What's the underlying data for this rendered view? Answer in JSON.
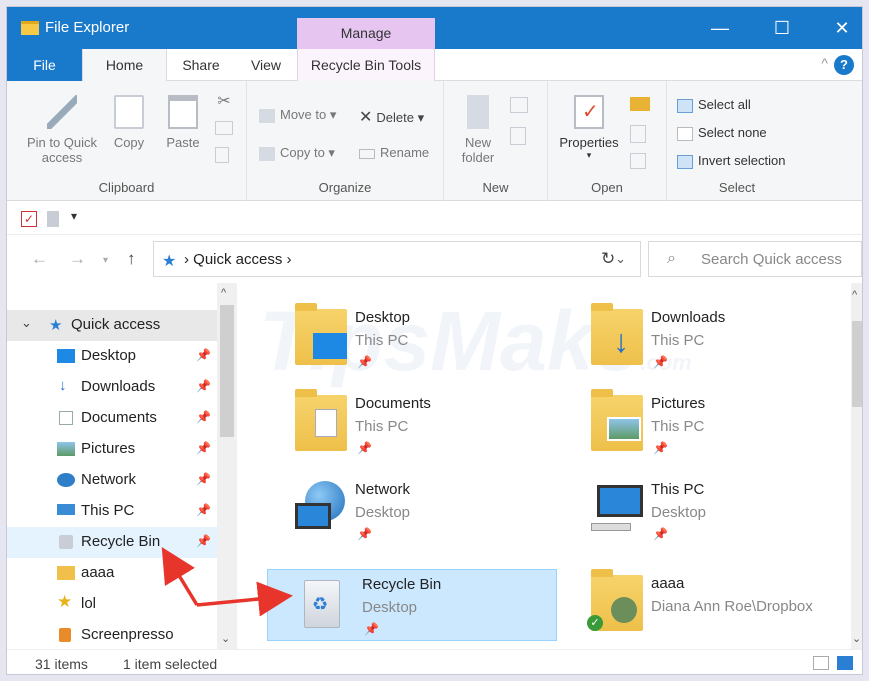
{
  "window": {
    "title": "File Explorer",
    "manage_tab": "Manage",
    "controls": {
      "minimize": "—",
      "maximize": "☐",
      "close": "✕"
    }
  },
  "ribbon_tabs": {
    "file": "File",
    "home": "Home",
    "share": "Share",
    "view": "View",
    "recycle_bin_tools": "Recycle Bin Tools",
    "collapse": "^",
    "help": "?"
  },
  "ribbon": {
    "clipboard": {
      "group": "Clipboard",
      "pin_line1": "Pin to Quick",
      "pin_line2": "access",
      "copy": "Copy",
      "paste": "Paste"
    },
    "organize": {
      "group": "Organize",
      "move_to": "Move to",
      "copy_to": "Copy to",
      "delete": "Delete",
      "rename": "Rename"
    },
    "new": {
      "group": "New",
      "new_folder_line1": "New",
      "new_folder_line2": "folder"
    },
    "open": {
      "group": "Open",
      "properties": "Properties"
    },
    "select": {
      "group": "Select",
      "select_all": "Select all",
      "select_none": "Select none",
      "invert_selection": "Invert selection"
    }
  },
  "address": {
    "path": "Quick access",
    "search_placeholder": "Search Quick access"
  },
  "nav": {
    "quick_access": "Quick access",
    "items": [
      {
        "label": "Desktop",
        "icon": "desktop-icon",
        "pinned": true
      },
      {
        "label": "Downloads",
        "icon": "download-icon",
        "pinned": true
      },
      {
        "label": "Documents",
        "icon": "documents-icon",
        "pinned": true
      },
      {
        "label": "Pictures",
        "icon": "pictures-icon",
        "pinned": true
      },
      {
        "label": "Network",
        "icon": "network-icon",
        "pinned": true
      },
      {
        "label": "This PC",
        "icon": "computer-icon",
        "pinned": true
      },
      {
        "label": "Recycle Bin",
        "icon": "recycle-bin-icon",
        "pinned": true
      },
      {
        "label": "aaaa",
        "icon": "user-folder-icon",
        "pinned": false
      },
      {
        "label": "lol",
        "icon": "star-folder-icon",
        "pinned": false
      },
      {
        "label": "Screenpresso",
        "icon": "app-icon",
        "pinned": false
      }
    ]
  },
  "content": {
    "watermark": "TipsMake",
    "watermark_sub": ".com",
    "tiles": [
      {
        "name": "Desktop",
        "location": "This PC",
        "icon": "desktop-folder-icon"
      },
      {
        "name": "Downloads",
        "location": "This PC",
        "icon": "downloads-folder-icon"
      },
      {
        "name": "Documents",
        "location": "This PC",
        "icon": "documents-folder-icon"
      },
      {
        "name": "Pictures",
        "location": "This PC",
        "icon": "pictures-folder-icon"
      },
      {
        "name": "Network",
        "location": "Desktop",
        "icon": "network-globe-icon"
      },
      {
        "name": "This PC",
        "location": "Desktop",
        "icon": "computer-icon"
      },
      {
        "name": "Recycle Bin",
        "location": "Desktop",
        "icon": "recycle-bin-icon",
        "selected": true
      },
      {
        "name": "aaaa",
        "location": "Diana Ann Roe\\Dropbox",
        "icon": "shared-folder-icon"
      }
    ]
  },
  "status": {
    "items": "31 items",
    "selected": "1 item selected"
  },
  "colors": {
    "titlebar": "#1979ca",
    "manage_tab": "#e6c6f1",
    "selection": "#cce8ff",
    "annotation_arrow": "#e8352b"
  }
}
